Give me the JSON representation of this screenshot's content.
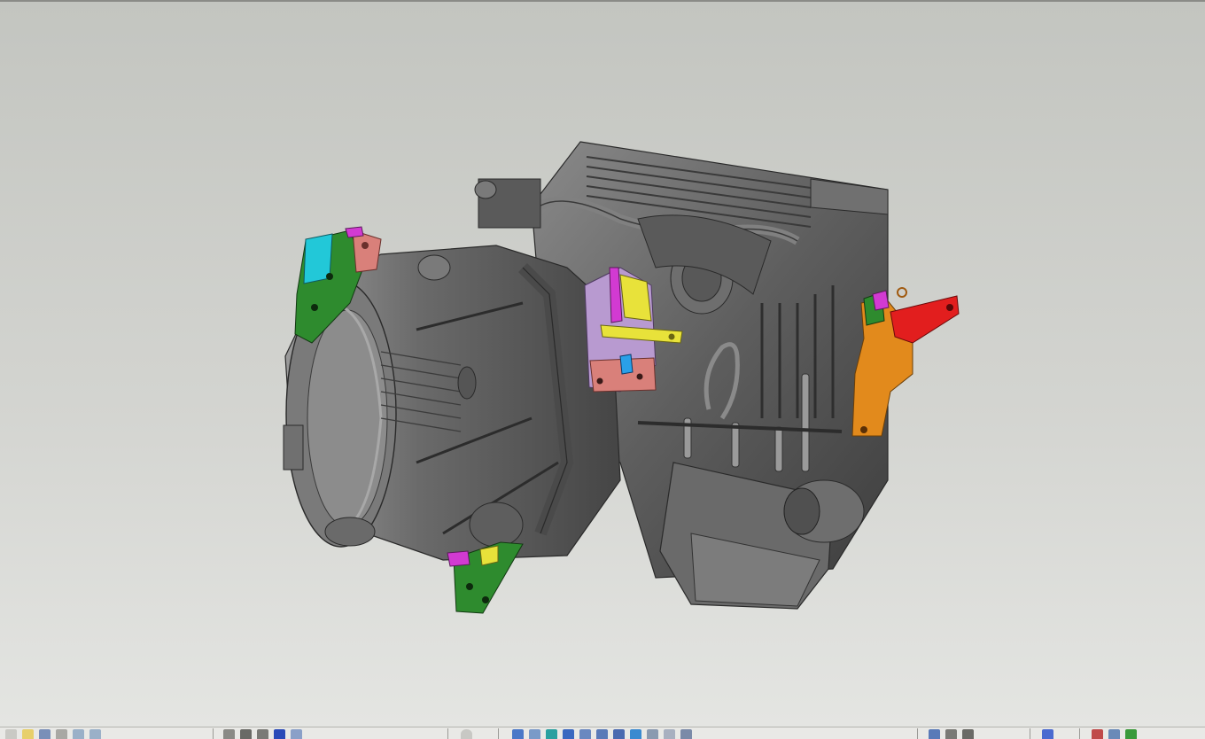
{
  "app": {
    "name": "",
    "document": ""
  },
  "viewport": {
    "model": "engine-transmission-assembly",
    "background_top": "#c3c5c0",
    "background_bottom": "#e4e5e2",
    "part_colors": {
      "engine_body": "#5f5f5f",
      "mount_green": "#2e8b2e",
      "mount_cyan": "#22c8d8",
      "mount_magenta": "#d23ad2",
      "mount_yellow": "#e8e23a",
      "mount_orange": "#e28a1c",
      "mount_red": "#e21e1e",
      "mount_salmon": "#d9807a",
      "mount_lavender": "#b89ad0",
      "mount_blue": "#2aa0e8"
    }
  },
  "toolbar": {
    "groups": [
      {
        "name": "standard",
        "icons": [
          "new-icon",
          "open-icon",
          "save-icon",
          "print-icon",
          "undo-icon",
          "redo-icon"
        ]
      },
      {
        "name": "view",
        "icons": [
          "fly-icon",
          "fit-all-icon",
          "pan-icon",
          "rotate-icon",
          "zoom-icon"
        ]
      },
      {
        "name": "render",
        "icons": [
          "normal-view-icon"
        ]
      },
      {
        "name": "views",
        "icons": [
          "iso-view-icon",
          "front-view-icon",
          "back-view-icon",
          "top-view-icon",
          "left-view-icon",
          "right-view-icon",
          "shading-icon",
          "shading-edges-icon",
          "wireframe-icon",
          "hide-show-icon",
          "swap-visible-icon"
        ]
      },
      {
        "name": "measure",
        "icons": [
          "measure-between-icon",
          "measure-item-icon",
          "measure-inertia-icon"
        ]
      },
      {
        "name": "analysis",
        "icons": [
          "clash-icon",
          "sectioning-icon",
          "distance-icon"
        ]
      }
    ]
  }
}
